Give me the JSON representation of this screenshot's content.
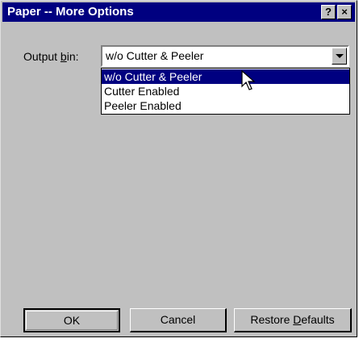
{
  "window": {
    "title": "Paper -- More Options",
    "help_button": "?",
    "close_button": "×"
  },
  "output_bin": {
    "label_prefix": "Output ",
    "label_accel": "b",
    "label_suffix": "in:",
    "selected_value": "w/o Cutter & Peeler",
    "options": [
      {
        "label": "w/o Cutter & Peeler",
        "highlighted": true
      },
      {
        "label": "Cutter Enabled",
        "highlighted": false
      },
      {
        "label": "Peeler Enabled",
        "highlighted": false
      }
    ]
  },
  "buttons": {
    "ok": "OK",
    "cancel": "Cancel",
    "restore_prefix": "Restore ",
    "restore_accel": "D",
    "restore_suffix": "efaults"
  },
  "colors": {
    "title_bar": "#000080",
    "selection": "#000080",
    "face": "#c0c0c0"
  }
}
